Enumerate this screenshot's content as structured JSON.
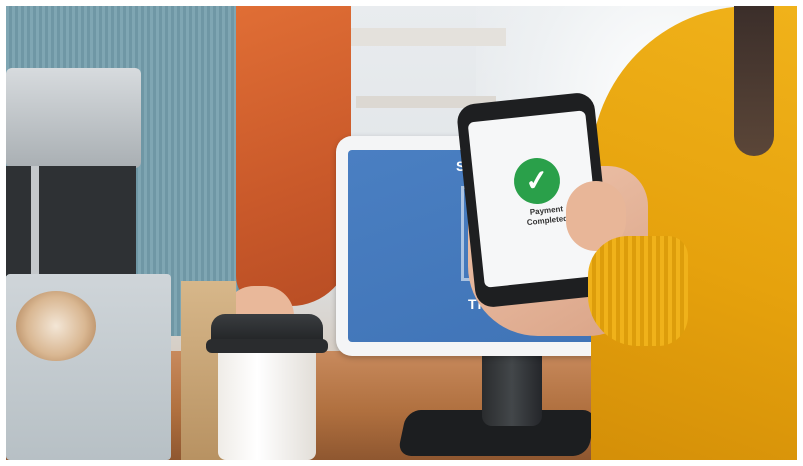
{
  "scene": {
    "description_icons": [
      "checkmark-icon",
      "qr-code-icon"
    ],
    "tablet": {
      "screen_text_top": "SC",
      "screen_text_bottom": "Tha",
      "screen_color": "#4479bd"
    },
    "phone": {
      "status_line_1": "Payment",
      "status_line_2": "Completed",
      "check_color": "#2aa04a",
      "check_glyph": "✓"
    },
    "colors": {
      "barista_sleeve": "#e06e35",
      "customer_sleeve": "#f0b21a",
      "counter": "#b0703f"
    }
  }
}
